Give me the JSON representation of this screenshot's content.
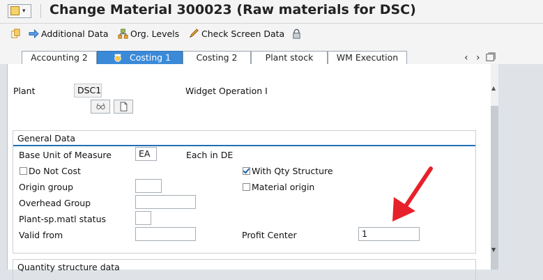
{
  "title": "Change Material 300023 (Raw materials for DSC)",
  "toolbar": {
    "additional_data": "Additional Data",
    "org_levels": "Org. Levels",
    "check_screen_data": "Check Screen Data"
  },
  "tabs": [
    "Accounting 2",
    "Costing 1",
    "Costing 2",
    "Plant stock",
    "WM Execution"
  ],
  "active_tab": "Costing 1",
  "plant": {
    "label": "Plant",
    "value": "DSC1",
    "description": "Widget Operation I"
  },
  "general_data": {
    "title": "General Data",
    "base_unit_label": "Base Unit of Measure",
    "base_unit_value": "EA",
    "base_unit_desc": "Each in DE",
    "do_not_cost_label": "Do Not Cost",
    "do_not_cost_checked": false,
    "with_qty_structure_label": "With Qty Structure",
    "with_qty_structure_checked": true,
    "origin_group_label": "Origin group",
    "origin_group_value": "",
    "material_origin_label": "Material origin",
    "material_origin_checked": false,
    "overhead_group_label": "Overhead Group",
    "overhead_group_value": "",
    "plant_sp_status_label": "Plant-sp.matl status",
    "plant_sp_status_value": "",
    "valid_from_label": "Valid from",
    "valid_from_value": "",
    "profit_center_label": "Profit Center",
    "profit_center_value": "1"
  },
  "quantity_structure": {
    "title": "Quantity structure data"
  },
  "colors": {
    "accent": "#3a8ad8",
    "arrow": "#e8202a",
    "group_line": "#1e6fb8"
  }
}
